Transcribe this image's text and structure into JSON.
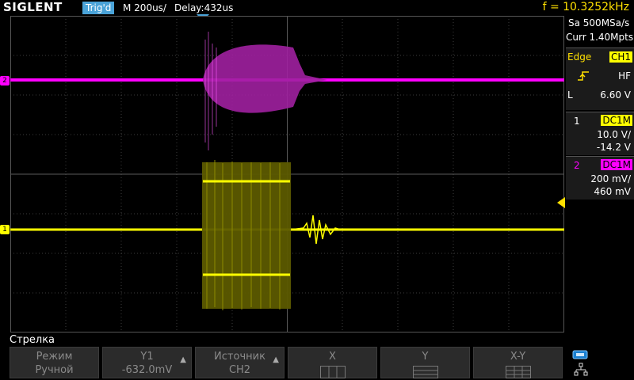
{
  "brand": "SIGLENT",
  "top": {
    "trig_status": "Trig'd",
    "timebase": "M 200us/",
    "delay": "Delay:432us",
    "frequency": "f = 10.3252kHz"
  },
  "acquire": {
    "sample_rate": "Sa 500MSa/s",
    "memory": "Curr 1.40Mpts"
  },
  "trigger": {
    "type": "Edge",
    "source": "CH1",
    "coupling": "HF",
    "level_label": "L",
    "level_value": "6.60 V"
  },
  "channels": [
    {
      "num": "1",
      "coupling": "DC1M",
      "scale": "10.0 V/",
      "offset": "-14.2 V",
      "color": "#ffff00"
    },
    {
      "num": "2",
      "coupling": "DC1M",
      "scale": "200 mV/",
      "offset": "460 mV",
      "color": "#ff00ff"
    }
  ],
  "markers": {
    "ch1": "1",
    "ch2": "2"
  },
  "menu": {
    "title": "Стрелка",
    "keys": [
      {
        "line1": "Режим",
        "line2": "Ручной"
      },
      {
        "line1": "Y1",
        "line2": "-632.0mV"
      },
      {
        "line1": "Источник",
        "line2": "CH2"
      },
      {
        "line1": "X",
        "line2": ""
      },
      {
        "line1": "Y",
        "line2": ""
      },
      {
        "line1": "X-Y",
        "line2": ""
      }
    ]
  },
  "colors": {
    "ch1": "#ffff00",
    "ch2": "#ff00ff",
    "grid": "#4a4a4a",
    "trigger_accent": "#ffe000",
    "badge": "#4aa3d8"
  }
}
